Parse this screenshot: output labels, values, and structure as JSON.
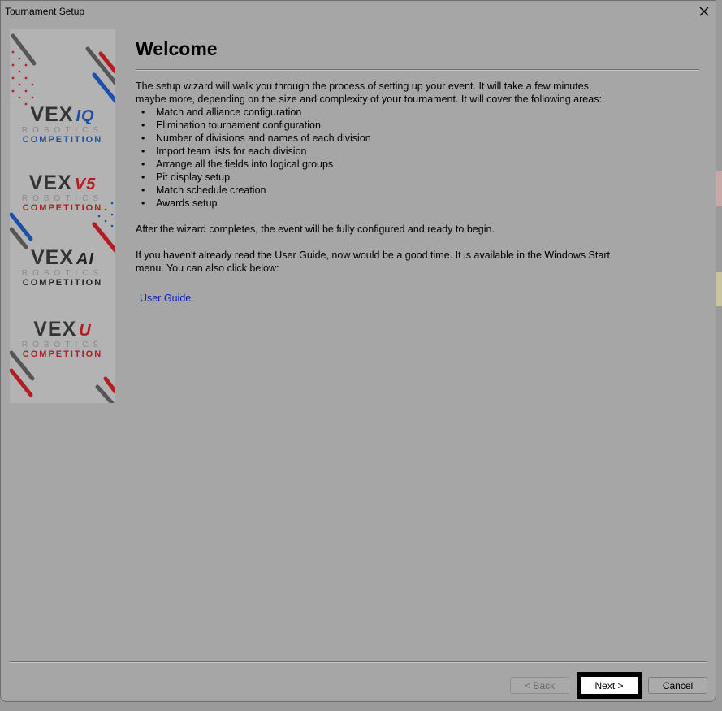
{
  "window": {
    "title": "Tournament Setup"
  },
  "sidebar": {
    "logos": [
      {
        "vex": "VEX",
        "suffix": "IQ",
        "robotics": "ROBOTICS",
        "competition": "COMPETITION",
        "color": "#1b4fa8"
      },
      {
        "vex": "VEX",
        "suffix": "V5",
        "robotics": "ROBOTICS",
        "competition": "COMPETITION",
        "color": "#b31c22"
      },
      {
        "vex": "VEX",
        "suffix": "AI",
        "robotics": "ROBOTICS",
        "competition": "COMPETITION",
        "color": "#222222"
      },
      {
        "vex": "VEX",
        "suffix": "U",
        "robotics": "ROBOTICS",
        "competition": "COMPETITION",
        "color": "#b31c22"
      }
    ]
  },
  "main": {
    "heading": "Welcome",
    "intro": "The setup wizard will walk you through the process of setting up your event.  It will take a few minutes, maybe more, depending on the size and complexity of your tournament.  It will cover the following areas:",
    "bullets": [
      "Match and alliance configuration",
      "Elimination tournament configuration",
      "Number of divisions and names of each division",
      "Import team lists for each division",
      "Arrange all the fields into logical groups",
      "Pit display setup",
      "Match schedule creation",
      "Awards setup"
    ],
    "after": "After the wizard completes, the event will be fully configured and ready to begin.",
    "guide_text": "If you haven't already read the User Guide, now would be a good time.  It is available in the Windows Start menu.  You can also click below:",
    "link": "User Guide"
  },
  "buttons": {
    "back": "< Back",
    "next": "Next >",
    "cancel": "Cancel"
  },
  "colors": {
    "accent_blue": "#1b4fa8",
    "accent_red": "#b31c22",
    "link": "#0a1fb8"
  }
}
